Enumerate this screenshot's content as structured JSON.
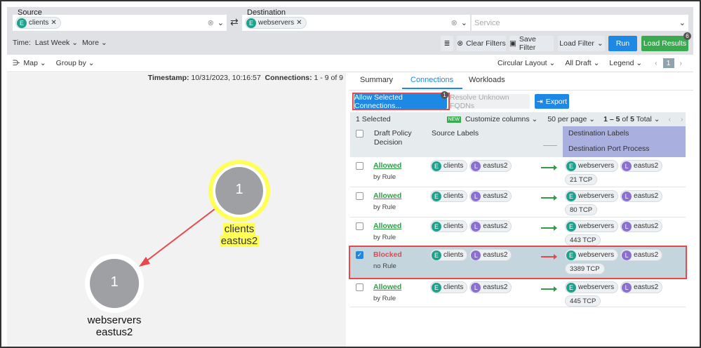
{
  "filters": {
    "source_label": "Source",
    "source_chip": "clients",
    "destination_label": "Destination",
    "destination_chip": "webservers",
    "service_placeholder": "Service",
    "time_label": "Time:",
    "time_value": "Last Week",
    "more": "More",
    "clear_filters": "Clear Filters",
    "save_filter": "Save Filter",
    "load_filter": "Load Filter",
    "run": "Run",
    "load_results": "Load Results",
    "load_results_badge": "6"
  },
  "toolbar": {
    "map": "Map",
    "group_by": "Group by",
    "circular_layout": "Circular Layout",
    "all_draft": "All Draft",
    "legend": "Legend",
    "page": "1"
  },
  "map": {
    "timestamp_label": "Timestamp:",
    "timestamp": "10/31/2023, 10:16:57",
    "connections_label": "Connections:",
    "connections": "1 - 9 of 9",
    "nodes": [
      {
        "count": "1",
        "name": "clients",
        "loc": "eastus2"
      },
      {
        "count": "1",
        "name": "webservers",
        "loc": "eastus2"
      }
    ]
  },
  "panel": {
    "tabs": [
      "Summary",
      "Connections",
      "Workloads"
    ],
    "allow_selected": "Allow Selected Connections...",
    "allow_badge": "1",
    "resolve": "Resolve Unknown FQDNs",
    "export": "Export",
    "selected": "1 Selected",
    "new_badge": "NEW",
    "customize": "Customize columns",
    "per_page": "50 per page",
    "range": "1 – 5",
    "of": "of",
    "total": "5",
    "total_label": "Total",
    "headers": {
      "decision": "Draft Policy Decision",
      "source": "Source Labels",
      "dest": "Destination Labels",
      "port": "Destination Port Process"
    },
    "rows": [
      {
        "decision": "Allowed",
        "sub": "by Rule",
        "src": [
          "clients",
          "eastus2"
        ],
        "dst": [
          "webservers",
          "eastus2"
        ],
        "port": "21 TCP",
        "checked": false
      },
      {
        "decision": "Allowed",
        "sub": "by Rule",
        "src": [
          "clients",
          "eastus2"
        ],
        "dst": [
          "webservers",
          "eastus2"
        ],
        "port": "80 TCP",
        "checked": false
      },
      {
        "decision": "Allowed",
        "sub": "by Rule",
        "src": [
          "clients",
          "eastus2"
        ],
        "dst": [
          "webservers",
          "eastus2"
        ],
        "port": "443 TCP",
        "checked": false
      },
      {
        "decision": "Blocked",
        "sub": "no Rule",
        "src": [
          "clients",
          "eastus2"
        ],
        "dst": [
          "webservers",
          "eastus2"
        ],
        "port": "3389 TCP",
        "checked": true
      },
      {
        "decision": "Allowed",
        "sub": "by Rule",
        "src": [
          "clients",
          "eastus2"
        ],
        "dst": [
          "webservers",
          "eastus2"
        ],
        "port": "445 TCP",
        "checked": false
      }
    ]
  },
  "colors": {
    "allowed": "#2e9e44",
    "blocked": "#e8474b",
    "primary": "#1e88e5",
    "success": "#3aaa50",
    "highlight": "#ffff55",
    "dest_header": "#a9afdf"
  }
}
